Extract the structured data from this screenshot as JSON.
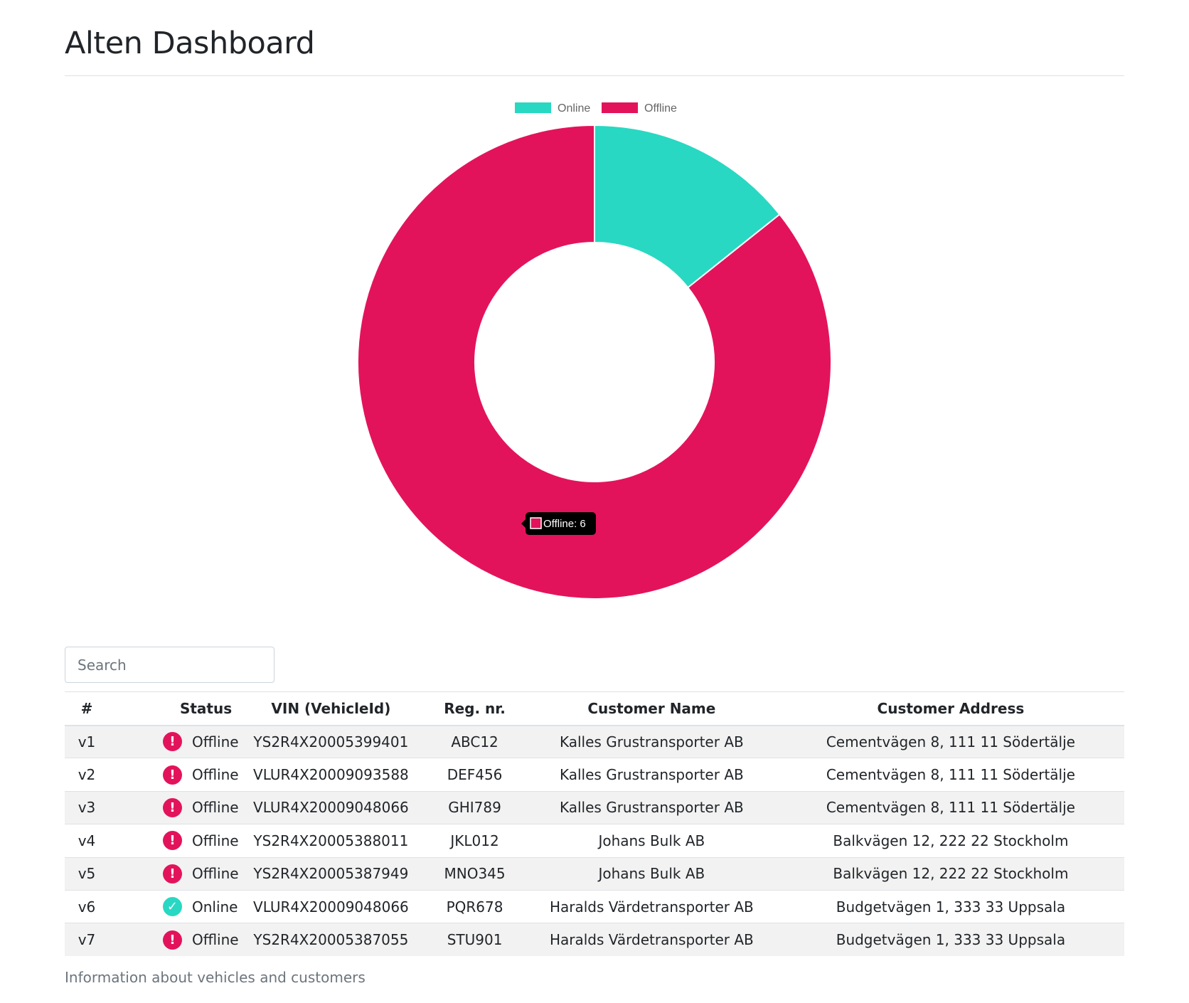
{
  "page": {
    "title": "Alten Dashboard"
  },
  "chart_data": {
    "type": "pie",
    "title": "",
    "legend_position": "top",
    "categories": [
      "Online",
      "Offline"
    ],
    "values": [
      1,
      6
    ],
    "colors": [
      "#28d8c2",
      "#e3135b"
    ],
    "tooltip": {
      "label": "Offline: 6"
    }
  },
  "search": {
    "placeholder": "Search",
    "value": ""
  },
  "table": {
    "headers": [
      "#",
      "Status",
      "VIN (VehicleId)",
      "Reg. nr.",
      "Customer Name",
      "Customer Address"
    ],
    "rows": [
      {
        "id": "v1",
        "status": "Offline",
        "icon": "exclamation-circle-icon",
        "vin": "YS2R4X20005399401",
        "reg": "ABC12",
        "name": "Kalles Grustransporter AB",
        "address": "Cementvägen 8, 111 11 Södertälje"
      },
      {
        "id": "v2",
        "status": "Offline",
        "icon": "exclamation-circle-icon",
        "vin": "VLUR4X20009093588",
        "reg": "DEF456",
        "name": "Kalles Grustransporter AB",
        "address": "Cementvägen 8, 111 11 Södertälje"
      },
      {
        "id": "v3",
        "status": "Offline",
        "icon": "exclamation-circle-icon",
        "vin": "VLUR4X20009048066",
        "reg": "GHI789",
        "name": "Kalles Grustransporter AB",
        "address": "Cementvägen 8, 111 11 Södertälje"
      },
      {
        "id": "v4",
        "status": "Offline",
        "icon": "exclamation-circle-icon",
        "vin": "YS2R4X20005388011",
        "reg": "JKL012",
        "name": "Johans Bulk AB",
        "address": "Balkvägen 12, 222 22 Stockholm"
      },
      {
        "id": "v5",
        "status": "Offline",
        "icon": "exclamation-circle-icon",
        "vin": "YS2R4X20005387949",
        "reg": "MNO345",
        "name": "Johans Bulk AB",
        "address": "Balkvägen 12, 222 22 Stockholm"
      },
      {
        "id": "v6",
        "status": "Online",
        "icon": "check-circle-icon",
        "vin": "VLUR4X20009048066",
        "reg": "PQR678",
        "name": "Haralds Värdetransporter AB",
        "address": "Budgetvägen 1, 333 33 Uppsala"
      },
      {
        "id": "v7",
        "status": "Offline",
        "icon": "exclamation-circle-icon",
        "vin": "YS2R4X20005387055",
        "reg": "STU901",
        "name": "Haralds Värdetransporter AB",
        "address": "Budgetvägen 1, 333 33 Uppsala"
      }
    ],
    "caption": "Information about vehicles and customers"
  }
}
